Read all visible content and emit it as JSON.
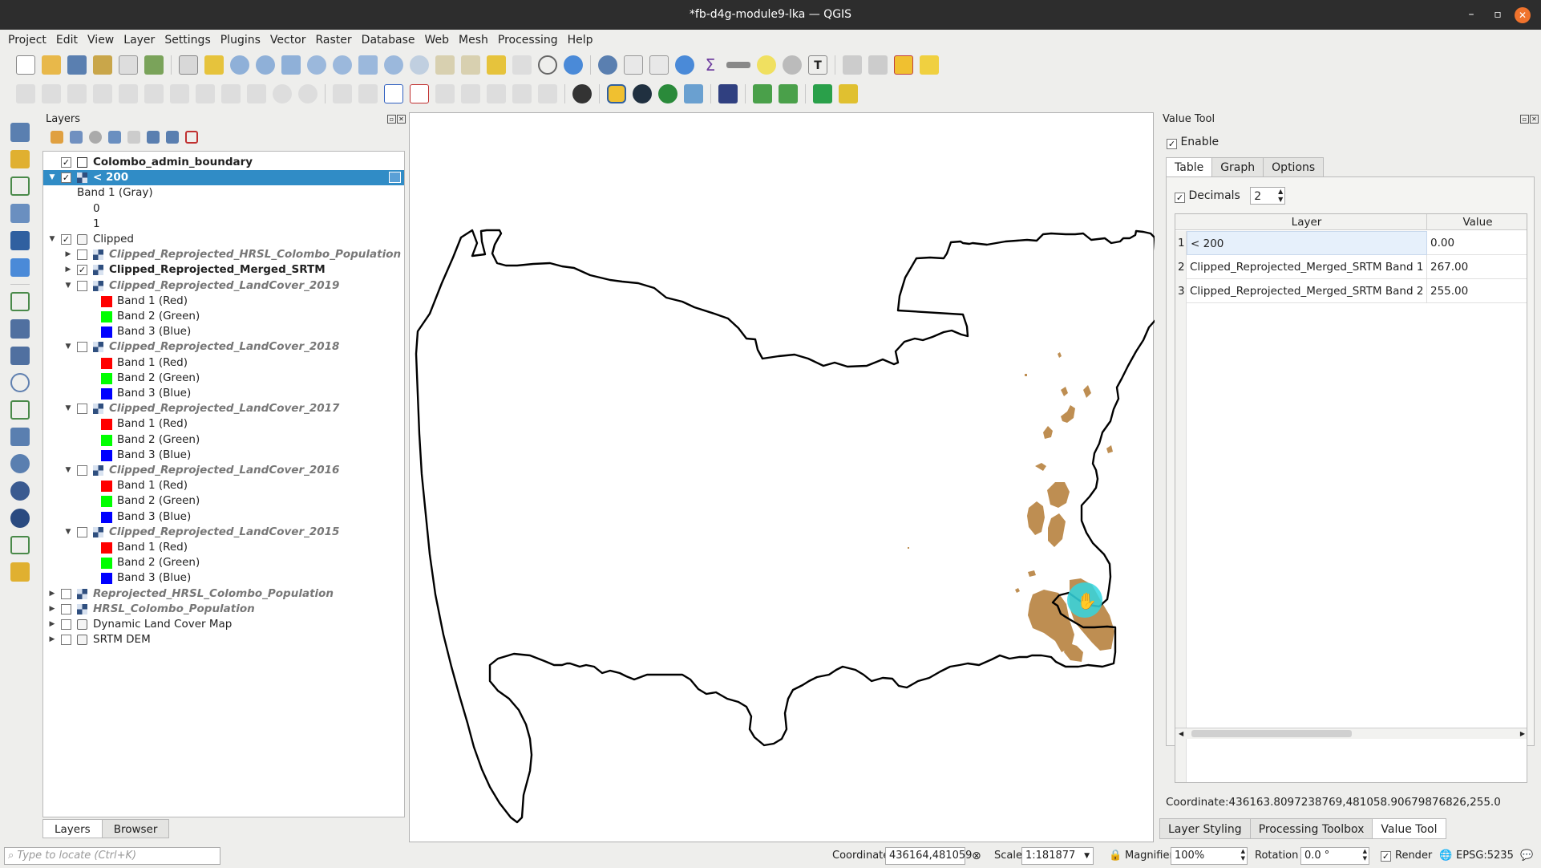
{
  "window": {
    "title": "*fb-d4g-module9-lka — QGIS"
  },
  "menu": [
    "Project",
    "Edit",
    "View",
    "Layer",
    "Settings",
    "Plugins",
    "Vector",
    "Raster",
    "Database",
    "Web",
    "Mesh",
    "Processing",
    "Help"
  ],
  "layers_panel": {
    "title": "Layers",
    "tree": [
      {
        "label": "Colombo_admin_boundary",
        "style": "bold",
        "checked": true,
        "indent": 0,
        "icon": "polygon-layer-icon"
      },
      {
        "label": "< 200",
        "style": "bold",
        "checked": true,
        "indent": 0,
        "icon": "raster-layer-icon",
        "selected": true,
        "expanded": true
      },
      {
        "label": "Band 1 (Gray)",
        "style": "normal",
        "indent": 1,
        "legend": true
      },
      {
        "label": "0",
        "style": "normal",
        "indent": 2,
        "legend": true
      },
      {
        "label": "1",
        "style": "normal",
        "indent": 2,
        "legend": true
      },
      {
        "label": "Clipped",
        "style": "normal",
        "checked": true,
        "indent": 0,
        "icon": "group-icon",
        "expanded": true
      },
      {
        "label": "Clipped_Reprojected_HRSL_Colombo_Population",
        "style": "italic",
        "checked": false,
        "indent": 1,
        "icon": "raster-layer-icon",
        "collapsed": true
      },
      {
        "label": "Clipped_Reprojected_Merged_SRTM",
        "style": "bold",
        "checked": true,
        "indent": 1,
        "icon": "raster-layer-icon",
        "collapsed": true
      },
      {
        "label": "Clipped_Reprojected_LandCover_2019",
        "style": "italic",
        "checked": false,
        "indent": 1,
        "icon": "raster-layer-icon",
        "expanded": true
      },
      {
        "label": "Band 1 (Red)",
        "swatch": "#ff0000",
        "indent": 2
      },
      {
        "label": "Band 2 (Green)",
        "swatch": "#00ff00",
        "indent": 2
      },
      {
        "label": "Band 3 (Blue)",
        "swatch": "#0000ff",
        "indent": 2
      },
      {
        "label": "Clipped_Reprojected_LandCover_2018",
        "style": "italic",
        "checked": false,
        "indent": 1,
        "icon": "raster-layer-icon",
        "expanded": true
      },
      {
        "label": "Band 1 (Red)",
        "swatch": "#ff0000",
        "indent": 2
      },
      {
        "label": "Band 2 (Green)",
        "swatch": "#00ff00",
        "indent": 2
      },
      {
        "label": "Band 3 (Blue)",
        "swatch": "#0000ff",
        "indent": 2
      },
      {
        "label": "Clipped_Reprojected_LandCover_2017",
        "style": "italic",
        "checked": false,
        "indent": 1,
        "icon": "raster-layer-icon",
        "expanded": true
      },
      {
        "label": "Band 1 (Red)",
        "swatch": "#ff0000",
        "indent": 2
      },
      {
        "label": "Band 2 (Green)",
        "swatch": "#00ff00",
        "indent": 2
      },
      {
        "label": "Band 3 (Blue)",
        "swatch": "#0000ff",
        "indent": 2
      },
      {
        "label": "Clipped_Reprojected_LandCover_2016",
        "style": "italic",
        "checked": false,
        "indent": 1,
        "icon": "raster-layer-icon",
        "expanded": true
      },
      {
        "label": "Band 1 (Red)",
        "swatch": "#ff0000",
        "indent": 2
      },
      {
        "label": "Band 2 (Green)",
        "swatch": "#00ff00",
        "indent": 2
      },
      {
        "label": "Band 3 (Blue)",
        "swatch": "#0000ff",
        "indent": 2
      },
      {
        "label": "Clipped_Reprojected_LandCover_2015",
        "style": "italic",
        "checked": false,
        "indent": 1,
        "icon": "raster-layer-icon",
        "expanded": true
      },
      {
        "label": "Band 1 (Red)",
        "swatch": "#ff0000",
        "indent": 2
      },
      {
        "label": "Band 2 (Green)",
        "swatch": "#00ff00",
        "indent": 2
      },
      {
        "label": "Band 3 (Blue)",
        "swatch": "#0000ff",
        "indent": 2
      },
      {
        "label": "Reprojected_HRSL_Colombo_Population",
        "style": "italic",
        "checked": false,
        "indent": 0,
        "icon": "raster-layer-icon",
        "collapsed": true
      },
      {
        "label": "HRSL_Colombo_Population",
        "style": "italic",
        "checked": false,
        "indent": 0,
        "icon": "raster-layer-icon",
        "collapsed": true
      },
      {
        "label": "Dynamic Land Cover Map",
        "style": "normal",
        "checked": false,
        "indent": 0,
        "icon": "group-icon",
        "collapsed": true
      },
      {
        "label": "SRTM DEM",
        "style": "normal",
        "checked": false,
        "indent": 0,
        "icon": "group-icon",
        "collapsed": true
      }
    ],
    "bottom_tabs": [
      "Layers",
      "Browser"
    ],
    "active_tab": "Layers"
  },
  "value_tool": {
    "title": "Value Tool",
    "enable_label": "Enable",
    "enable_checked": true,
    "tabs": [
      "Table",
      "Graph",
      "Options"
    ],
    "active_tab": "Table",
    "decimals_label": "Decimals",
    "decimals_value": "2",
    "columns": [
      "Layer",
      "Value"
    ],
    "rows": [
      {
        "n": "1",
        "layer": "< 200",
        "value": "0.00"
      },
      {
        "n": "2",
        "layer": "Clipped_Reprojected_Merged_SRTM Band 1",
        "value": "267.00"
      },
      {
        "n": "3",
        "layer": "Clipped_Reprojected_Merged_SRTM Band 2",
        "value": "255.00"
      }
    ],
    "coordinate_text": "Coordinate:436163.8097238769,481058.90679876826,255.0"
  },
  "right_tabs": [
    "Layer Styling",
    "Processing Toolbox",
    "Value Tool"
  ],
  "right_active_tab": "Value Tool",
  "statusbar": {
    "locate_placeholder": "Type to locate (Ctrl+K)",
    "coordinate_label": "Coordinate",
    "coordinate_value": "436164,481059",
    "scale_label": "Scale",
    "scale_value": "1:181877",
    "magnifier_label": "Magnifier",
    "magnifier_value": "100%",
    "rotation_label": "Rotation",
    "rotation_value": "0.0 °",
    "render_label": "Render",
    "render_checked": true,
    "crs": "EPSG:5235"
  },
  "colors": {
    "selection": "#308cc6",
    "elevation_fill": "#b98544",
    "cursor_halo": "#33d6e0"
  }
}
